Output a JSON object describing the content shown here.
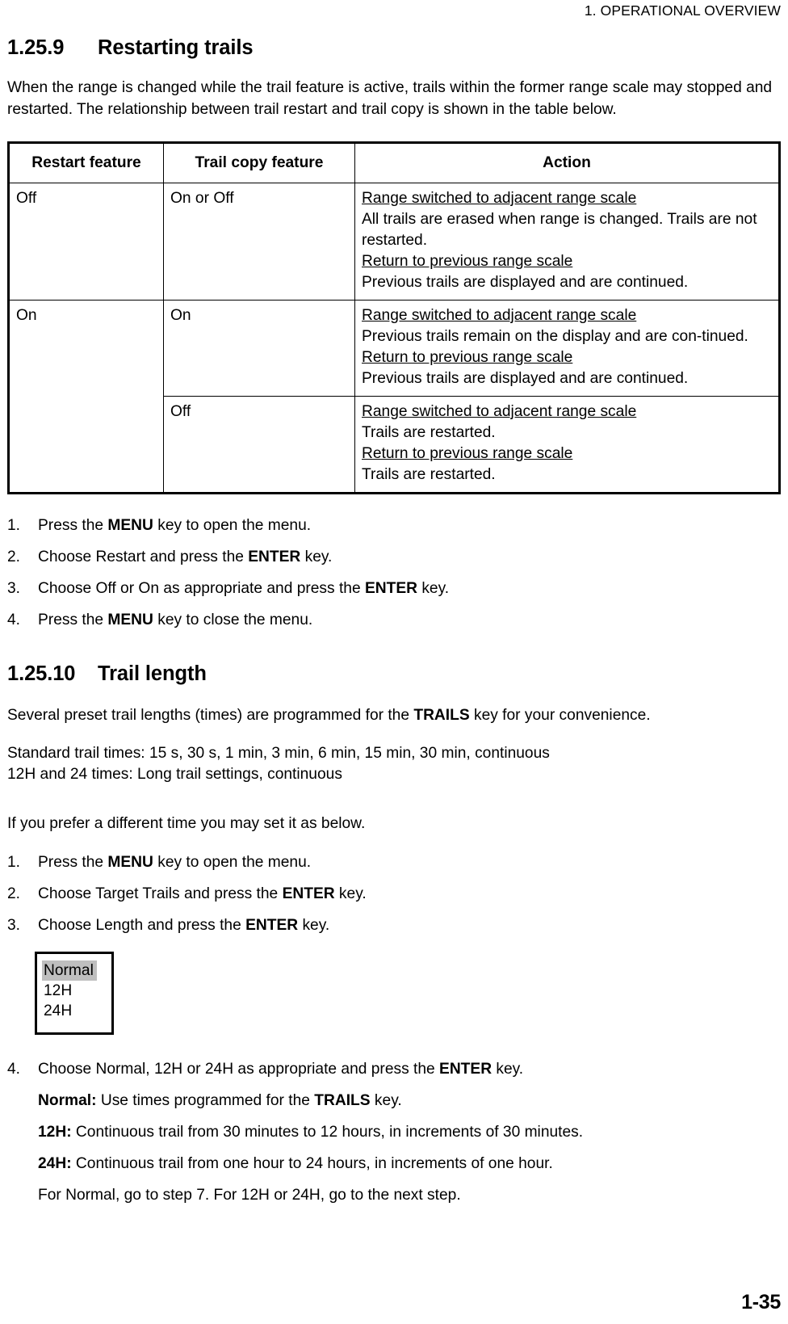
{
  "header": {
    "running_head": "1. OPERATIONAL OVERVIEW"
  },
  "footer": {
    "page_number": "1-35"
  },
  "section_1": {
    "number": "1.25.9",
    "title": "Restarting trails",
    "intro": "When the range is changed while the trail feature is active, trails within the former range scale may stopped and restarted. The relationship between trail restart and trail copy is shown in the table below.",
    "table": {
      "headers": [
        "Restart feature",
        "Trail copy feature",
        "Action"
      ],
      "rows": [
        {
          "restart": "Off",
          "copy": "On or Off",
          "action": [
            {
              "type": "underline",
              "text": "Range switched to adjacent range scale"
            },
            {
              "type": "plain",
              "text": "All trails are erased when range is changed. Trails are not restarted."
            },
            {
              "type": "underline",
              "text": "Return to previous range scale"
            },
            {
              "type": "plain",
              "text": "Previous trails are displayed and are continued."
            }
          ]
        },
        {
          "restart": "On",
          "copy": "On",
          "action": [
            {
              "type": "underline",
              "text": "Range switched to adjacent range scale"
            },
            {
              "type": "plain",
              "text": "Previous trails remain on the display and are con-tinued."
            },
            {
              "type": "underline",
              "text": "Return to previous range scale"
            },
            {
              "type": "plain",
              "text": "Previous trails are displayed and are continued."
            }
          ]
        },
        {
          "restart": "",
          "copy": "Off",
          "action": [
            {
              "type": "underline",
              "text": "Range switched to adjacent range scale"
            },
            {
              "type": "plain",
              "text": "Trails are restarted."
            },
            {
              "type": "underline",
              "text": "Return to previous range scale"
            },
            {
              "type": "plain",
              "text": "Trails are restarted."
            }
          ]
        }
      ]
    },
    "steps": [
      {
        "marker": "1.",
        "pre": "Press the ",
        "bold": "MENU",
        "post": " key to open the menu."
      },
      {
        "marker": "2.",
        "pre": "Choose Restart and press the ",
        "bold": "ENTER",
        "post": " key."
      },
      {
        "marker": "3.",
        "pre": "Choose Off or On as appropriate and press the ",
        "bold": "ENTER",
        "post": " key."
      },
      {
        "marker": "4.",
        "pre": "Press the ",
        "bold": "MENU",
        "post": " key to close the menu."
      }
    ]
  },
  "section_2": {
    "number": "1.25.10",
    "title": "Trail length",
    "intro_pre": "Several preset trail lengths (times) are programmed for the ",
    "intro_bold": "TRAILS",
    "intro_post": " key for your convenience.",
    "times_line_1": "Standard trail times: 15 s, 30 s, 1 min, 3 min, 6 min, 15 min, 30 min, continuous",
    "times_line_2": "12H and 24 times: Long trail settings, continuous",
    "prefer_line": "If you prefer a different time you may set it as below.",
    "steps": [
      {
        "marker": "1.",
        "pre": "Press the ",
        "bold": "MENU",
        "post": " key to open the menu."
      },
      {
        "marker": "2.",
        "pre": "Choose Target Trails and press the ",
        "bold": "ENTER",
        "post": " key."
      },
      {
        "marker": "3.",
        "pre": "Choose Length and press the ",
        "bold": "ENTER",
        "post": " key."
      }
    ],
    "menu_figure": {
      "items": [
        "Normal",
        "12H",
        "24H"
      ],
      "selected": "Normal",
      "highlight_color": "#bfbfbf"
    },
    "step4": {
      "marker": "4.",
      "pre": "Choose Normal, 12H or 24H as appropriate and press the ",
      "bold": "ENTER",
      "post": " key.",
      "sublines": [
        {
          "bold": "Normal:",
          "pre": " Use times programmed for the ",
          "bold2": "TRAILS",
          "post": " key."
        },
        {
          "bold": "12H:",
          "pre": " Continuous trail from 30 minutes to 12 hours, in increments of 30 minutes.",
          "bold2": "",
          "post": ""
        },
        {
          "bold": "24H:",
          "pre": " Continuous trail from one hour to 24 hours, in increments of one hour.",
          "bold2": "",
          "post": ""
        },
        {
          "bold": "",
          "pre": "For Normal, go to step 7. For 12H or 24H, go to the next step.",
          "bold2": "",
          "post": ""
        }
      ]
    }
  }
}
